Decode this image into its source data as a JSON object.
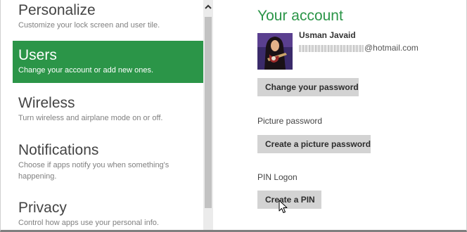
{
  "nav": {
    "items": [
      {
        "title": "Personalize",
        "desc": "Customize your lock screen and user tile."
      },
      {
        "title": "Users",
        "desc": "Change your account or add new ones."
      },
      {
        "title": "Wireless",
        "desc": "Turn wireless and airplane mode on or off."
      },
      {
        "title": "Notifications",
        "desc": "Choose if apps notify you when something's happening."
      },
      {
        "title": "Privacy",
        "desc": "Control how apps use your personal info."
      }
    ],
    "selected": "Users"
  },
  "account": {
    "title": "Your account",
    "name": "Usman Javaid",
    "email_visible": "@hotmail.com",
    "email_prefix_redacted": true
  },
  "buttons": {
    "change_password": "Change your password",
    "create_picture_password": "Create a picture password",
    "create_pin": "Create a PIN"
  },
  "sections": {
    "picture_password": "Picture password",
    "pin_logon": "PIN Logon"
  },
  "icons": {
    "scroll_up": "chevron-up-icon",
    "cursor": "mouse-cursor-icon",
    "avatar": "user-avatar"
  },
  "colors": {
    "accent": "#2b9548",
    "button_bg": "#d3d3d3",
    "scroll_track": "#ebebeb",
    "scroll_thumb": "#c2c2c2"
  }
}
